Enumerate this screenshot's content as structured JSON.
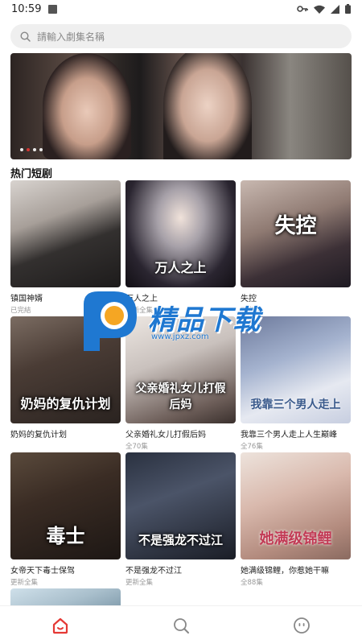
{
  "status_bar": {
    "time": "10:59",
    "icons": [
      "key-icon",
      "wifi-icon",
      "signal-icon",
      "battery-icon"
    ]
  },
  "search": {
    "placeholder": "請輸入劇集名稱",
    "icon": "search-icon"
  },
  "banner": {
    "page_count": 4,
    "active_index": 1
  },
  "section": {
    "title": "热门短剧"
  },
  "dramas": [
    {
      "name": "镇国神婿",
      "status": "已完結",
      "poster_text": ""
    },
    {
      "name": "万人之上",
      "status": "更新全集",
      "poster_text": "万人之上"
    },
    {
      "name": "失控",
      "status": "已完結",
      "poster_text": "失控"
    },
    {
      "name": "奶妈的复仇计划",
      "status": "",
      "poster_text": "奶妈的复仇计划"
    },
    {
      "name": "父亲婚礼女儿打假后妈",
      "status": "全70集",
      "poster_text": "父亲婚礼女儿打假后妈"
    },
    {
      "name": "我靠三个男人走上人生巅峰",
      "status": "全76集",
      "poster_text": "我靠三个男人走上"
    },
    {
      "name": "女帝天下毒士保驾",
      "status": "更新全集",
      "poster_text": "毒士"
    },
    {
      "name": "不是强龙不过江",
      "status": "更新全集",
      "poster_text": "不是强龙不过江"
    },
    {
      "name": "她满级锦鲤，你惹她干嘛",
      "status": "全88集",
      "poster_text": "她满级锦鲤"
    }
  ],
  "watermark": {
    "text": "精品下载",
    "url": "www.jpxz.com"
  },
  "bottom_nav": [
    {
      "icon": "home-icon",
      "active": true,
      "color": "#e53935"
    },
    {
      "icon": "search-icon",
      "active": false,
      "color": "#888888"
    },
    {
      "icon": "profile-icon",
      "active": false,
      "color": "#888888"
    }
  ],
  "colors": {
    "accent": "#e53935",
    "watermark_blue": "#1f78d1",
    "watermark_orange": "#f5a623"
  }
}
